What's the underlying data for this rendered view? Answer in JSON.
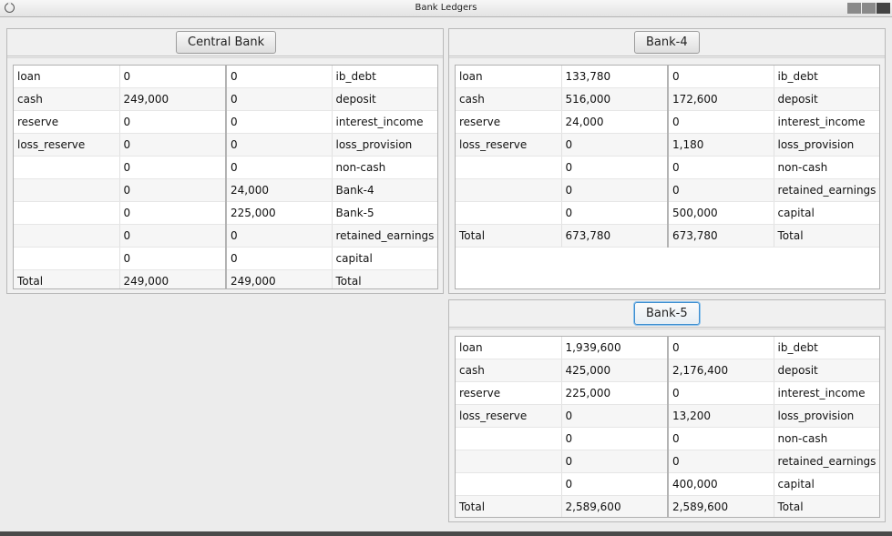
{
  "window": {
    "title": "Bank Ledgers"
  },
  "panels": {
    "central": {
      "name": "Central Bank",
      "rows": [
        [
          "loan",
          "0",
          "0",
          "ib_debt"
        ],
        [
          "cash",
          "249,000",
          "0",
          "deposit"
        ],
        [
          "reserve",
          "0",
          "0",
          "interest_income"
        ],
        [
          "loss_reserve",
          "0",
          "0",
          "loss_provision"
        ],
        [
          "",
          "0",
          "0",
          "non-cash"
        ],
        [
          "",
          "0",
          "24,000",
          "Bank-4"
        ],
        [
          "",
          "0",
          "225,000",
          "Bank-5"
        ],
        [
          "",
          "0",
          "0",
          "retained_earnings"
        ],
        [
          "",
          "0",
          "0",
          "capital"
        ],
        [
          "Total",
          "249,000",
          "249,000",
          "Total"
        ]
      ]
    },
    "bank4": {
      "name": "Bank-4",
      "rows": [
        [
          "loan",
          "133,780",
          "0",
          "ib_debt"
        ],
        [
          "cash",
          "516,000",
          "172,600",
          "deposit"
        ],
        [
          "reserve",
          "24,000",
          "0",
          "interest_income"
        ],
        [
          "loss_reserve",
          "0",
          "1,180",
          "loss_provision"
        ],
        [
          "",
          "0",
          "0",
          "non-cash"
        ],
        [
          "",
          "0",
          "0",
          "retained_earnings"
        ],
        [
          "",
          "0",
          "500,000",
          "capital"
        ],
        [
          "Total",
          "673,780",
          "673,780",
          "Total"
        ]
      ]
    },
    "bank5": {
      "name": "Bank-5",
      "rows": [
        [
          "loan",
          "1,939,600",
          "0",
          "ib_debt"
        ],
        [
          "cash",
          "425,000",
          "2,176,400",
          "deposit"
        ],
        [
          "reserve",
          "225,000",
          "0",
          "interest_income"
        ],
        [
          "loss_reserve",
          "0",
          "13,200",
          "loss_provision"
        ],
        [
          "",
          "0",
          "0",
          "non-cash"
        ],
        [
          "",
          "0",
          "0",
          "retained_earnings"
        ],
        [
          "",
          "0",
          "400,000",
          "capital"
        ],
        [
          "Total",
          "2,589,600",
          "2,589,600",
          "Total"
        ]
      ]
    }
  }
}
